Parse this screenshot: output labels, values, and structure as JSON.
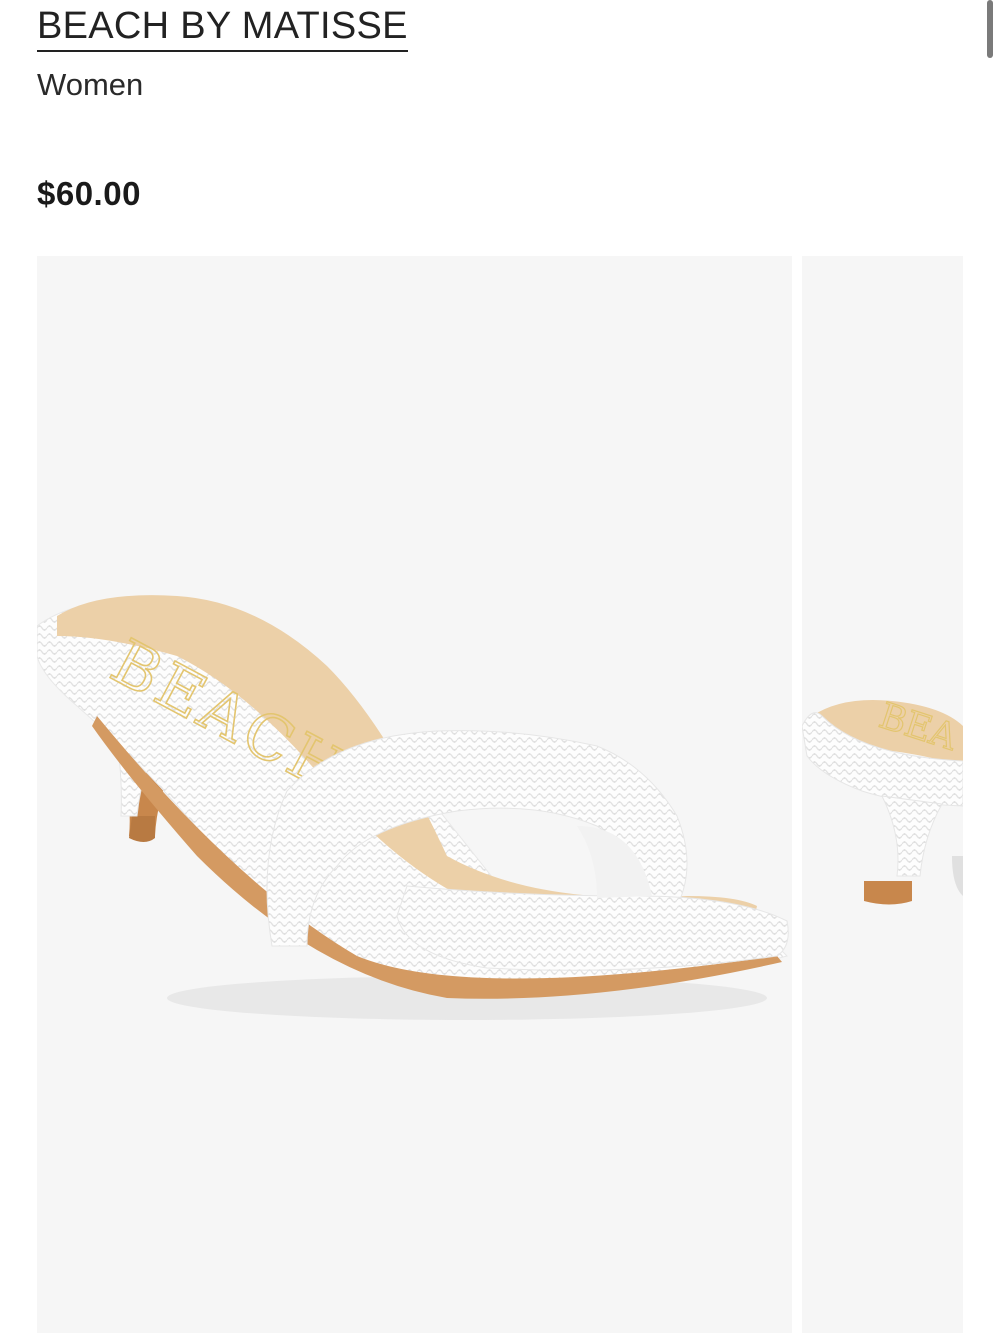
{
  "product": {
    "brand": "BEACH BY MATISSE",
    "category": "Women",
    "price": "$60.00"
  },
  "gallery": {
    "images": [
      {
        "name": "product-image-1"
      },
      {
        "name": "product-image-2"
      }
    ]
  },
  "colors": {
    "background": "#ffffff",
    "image_background": "#f6f6f6",
    "shoe_white": "#ffffff",
    "footbed_tan": "#ecd0a8",
    "heel_tan": "#c8874c",
    "logo_gold": "#e3c56f"
  }
}
